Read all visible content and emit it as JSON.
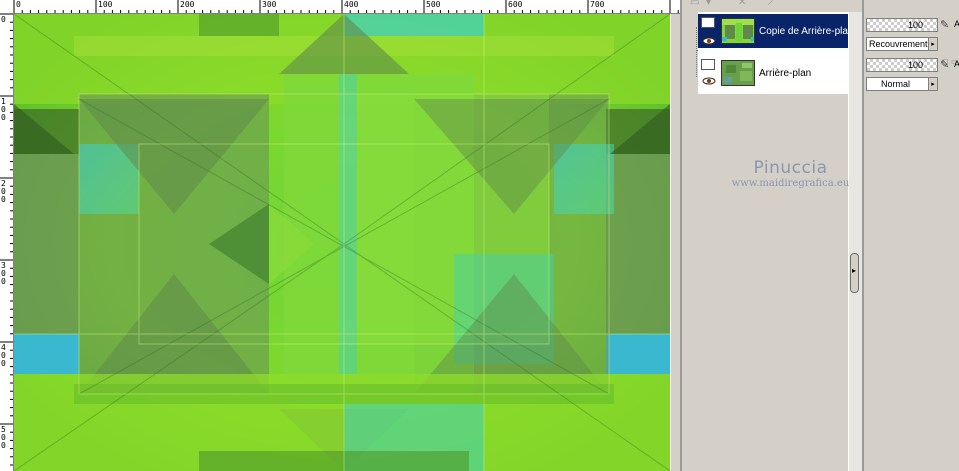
{
  "ruler": {
    "h_labels": [
      "0",
      "100",
      "200",
      "300",
      "400",
      "500",
      "600",
      "700"
    ],
    "v_labels": [
      "0",
      "1\n0\n0",
      "2\n0\n0",
      "3\n0\n0",
      "4\n0\n0",
      "5\n0\n0"
    ]
  },
  "layers_palette": {
    "layers": [
      {
        "name": "Copie de Arrière-plan",
        "selected": true
      },
      {
        "name": "Arrière-plan",
        "selected": false
      }
    ],
    "properties": [
      {
        "opacity": "100",
        "blend_mode": "Recouvrement",
        "lock_label": "A"
      },
      {
        "opacity": "100",
        "blend_mode": "Normal",
        "lock_label": "A"
      }
    ]
  },
  "watermark": {
    "name": "Pinuccia",
    "url": "www.maidiregrafica.eu"
  },
  "colors": {
    "selection": "#0a246a",
    "workspace": "#6f8ab2",
    "panel": "#d4d0c8",
    "canvas_green": "#7ed321",
    "canvas_cyan": "#37c8d8",
    "canvas_dark": "#5a7a4a"
  }
}
